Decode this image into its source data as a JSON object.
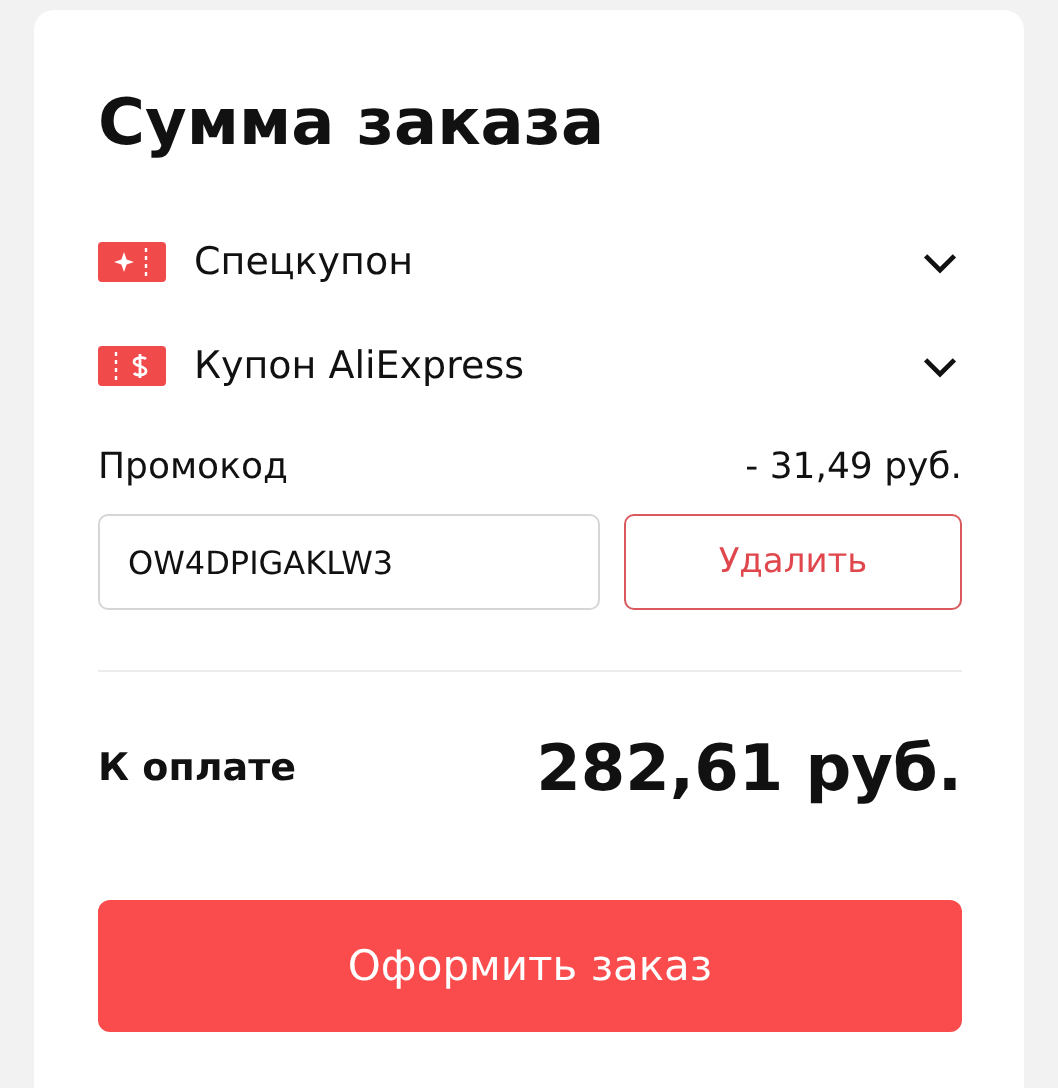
{
  "title": "Сумма заказа",
  "coupons": [
    {
      "kind": "special",
      "label": "Спецкупон",
      "expanded": false
    },
    {
      "kind": "store",
      "label": "Купон AliExpress",
      "expanded": false
    }
  ],
  "promo": {
    "label": "Промокод",
    "discount": "- 31,49 руб.",
    "value": "OW4DPIGAKLW3",
    "remove_button": "Удалить"
  },
  "total": {
    "label": "К оплате",
    "amount": "282,61 руб."
  },
  "checkout_button": "Оформить заказ"
}
